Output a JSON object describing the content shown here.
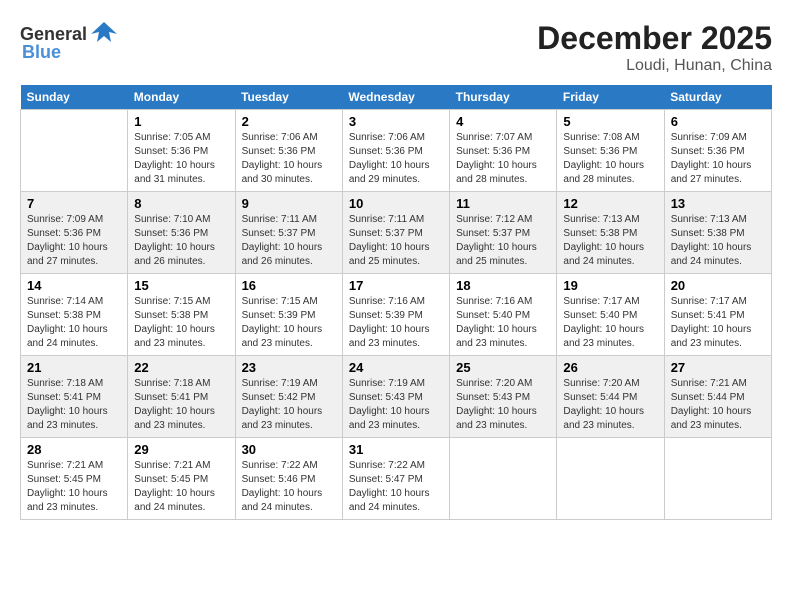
{
  "header": {
    "logo_general": "General",
    "logo_blue": "Blue",
    "month": "December 2025",
    "location": "Loudi, Hunan, China"
  },
  "columns": [
    "Sunday",
    "Monday",
    "Tuesday",
    "Wednesday",
    "Thursday",
    "Friday",
    "Saturday"
  ],
  "weeks": [
    {
      "days": [
        {
          "num": "",
          "info": ""
        },
        {
          "num": "1",
          "info": "Sunrise: 7:05 AM\nSunset: 5:36 PM\nDaylight: 10 hours\nand 31 minutes."
        },
        {
          "num": "2",
          "info": "Sunrise: 7:06 AM\nSunset: 5:36 PM\nDaylight: 10 hours\nand 30 minutes."
        },
        {
          "num": "3",
          "info": "Sunrise: 7:06 AM\nSunset: 5:36 PM\nDaylight: 10 hours\nand 29 minutes."
        },
        {
          "num": "4",
          "info": "Sunrise: 7:07 AM\nSunset: 5:36 PM\nDaylight: 10 hours\nand 28 minutes."
        },
        {
          "num": "5",
          "info": "Sunrise: 7:08 AM\nSunset: 5:36 PM\nDaylight: 10 hours\nand 28 minutes."
        },
        {
          "num": "6",
          "info": "Sunrise: 7:09 AM\nSunset: 5:36 PM\nDaylight: 10 hours\nand 27 minutes."
        }
      ]
    },
    {
      "days": [
        {
          "num": "7",
          "info": "Sunrise: 7:09 AM\nSunset: 5:36 PM\nDaylight: 10 hours\nand 27 minutes."
        },
        {
          "num": "8",
          "info": "Sunrise: 7:10 AM\nSunset: 5:36 PM\nDaylight: 10 hours\nand 26 minutes."
        },
        {
          "num": "9",
          "info": "Sunrise: 7:11 AM\nSunset: 5:37 PM\nDaylight: 10 hours\nand 26 minutes."
        },
        {
          "num": "10",
          "info": "Sunrise: 7:11 AM\nSunset: 5:37 PM\nDaylight: 10 hours\nand 25 minutes."
        },
        {
          "num": "11",
          "info": "Sunrise: 7:12 AM\nSunset: 5:37 PM\nDaylight: 10 hours\nand 25 minutes."
        },
        {
          "num": "12",
          "info": "Sunrise: 7:13 AM\nSunset: 5:38 PM\nDaylight: 10 hours\nand 24 minutes."
        },
        {
          "num": "13",
          "info": "Sunrise: 7:13 AM\nSunset: 5:38 PM\nDaylight: 10 hours\nand 24 minutes."
        }
      ]
    },
    {
      "days": [
        {
          "num": "14",
          "info": "Sunrise: 7:14 AM\nSunset: 5:38 PM\nDaylight: 10 hours\nand 24 minutes."
        },
        {
          "num": "15",
          "info": "Sunrise: 7:15 AM\nSunset: 5:38 PM\nDaylight: 10 hours\nand 23 minutes."
        },
        {
          "num": "16",
          "info": "Sunrise: 7:15 AM\nSunset: 5:39 PM\nDaylight: 10 hours\nand 23 minutes."
        },
        {
          "num": "17",
          "info": "Sunrise: 7:16 AM\nSunset: 5:39 PM\nDaylight: 10 hours\nand 23 minutes."
        },
        {
          "num": "18",
          "info": "Sunrise: 7:16 AM\nSunset: 5:40 PM\nDaylight: 10 hours\nand 23 minutes."
        },
        {
          "num": "19",
          "info": "Sunrise: 7:17 AM\nSunset: 5:40 PM\nDaylight: 10 hours\nand 23 minutes."
        },
        {
          "num": "20",
          "info": "Sunrise: 7:17 AM\nSunset: 5:41 PM\nDaylight: 10 hours\nand 23 minutes."
        }
      ]
    },
    {
      "days": [
        {
          "num": "21",
          "info": "Sunrise: 7:18 AM\nSunset: 5:41 PM\nDaylight: 10 hours\nand 23 minutes."
        },
        {
          "num": "22",
          "info": "Sunrise: 7:18 AM\nSunset: 5:41 PM\nDaylight: 10 hours\nand 23 minutes."
        },
        {
          "num": "23",
          "info": "Sunrise: 7:19 AM\nSunset: 5:42 PM\nDaylight: 10 hours\nand 23 minutes."
        },
        {
          "num": "24",
          "info": "Sunrise: 7:19 AM\nSunset: 5:43 PM\nDaylight: 10 hours\nand 23 minutes."
        },
        {
          "num": "25",
          "info": "Sunrise: 7:20 AM\nSunset: 5:43 PM\nDaylight: 10 hours\nand 23 minutes."
        },
        {
          "num": "26",
          "info": "Sunrise: 7:20 AM\nSunset: 5:44 PM\nDaylight: 10 hours\nand 23 minutes."
        },
        {
          "num": "27",
          "info": "Sunrise: 7:21 AM\nSunset: 5:44 PM\nDaylight: 10 hours\nand 23 minutes."
        }
      ]
    },
    {
      "days": [
        {
          "num": "28",
          "info": "Sunrise: 7:21 AM\nSunset: 5:45 PM\nDaylight: 10 hours\nand 23 minutes."
        },
        {
          "num": "29",
          "info": "Sunrise: 7:21 AM\nSunset: 5:45 PM\nDaylight: 10 hours\nand 24 minutes."
        },
        {
          "num": "30",
          "info": "Sunrise: 7:22 AM\nSunset: 5:46 PM\nDaylight: 10 hours\nand 24 minutes."
        },
        {
          "num": "31",
          "info": "Sunrise: 7:22 AM\nSunset: 5:47 PM\nDaylight: 10 hours\nand 24 minutes."
        },
        {
          "num": "",
          "info": ""
        },
        {
          "num": "",
          "info": ""
        },
        {
          "num": "",
          "info": ""
        }
      ]
    }
  ]
}
